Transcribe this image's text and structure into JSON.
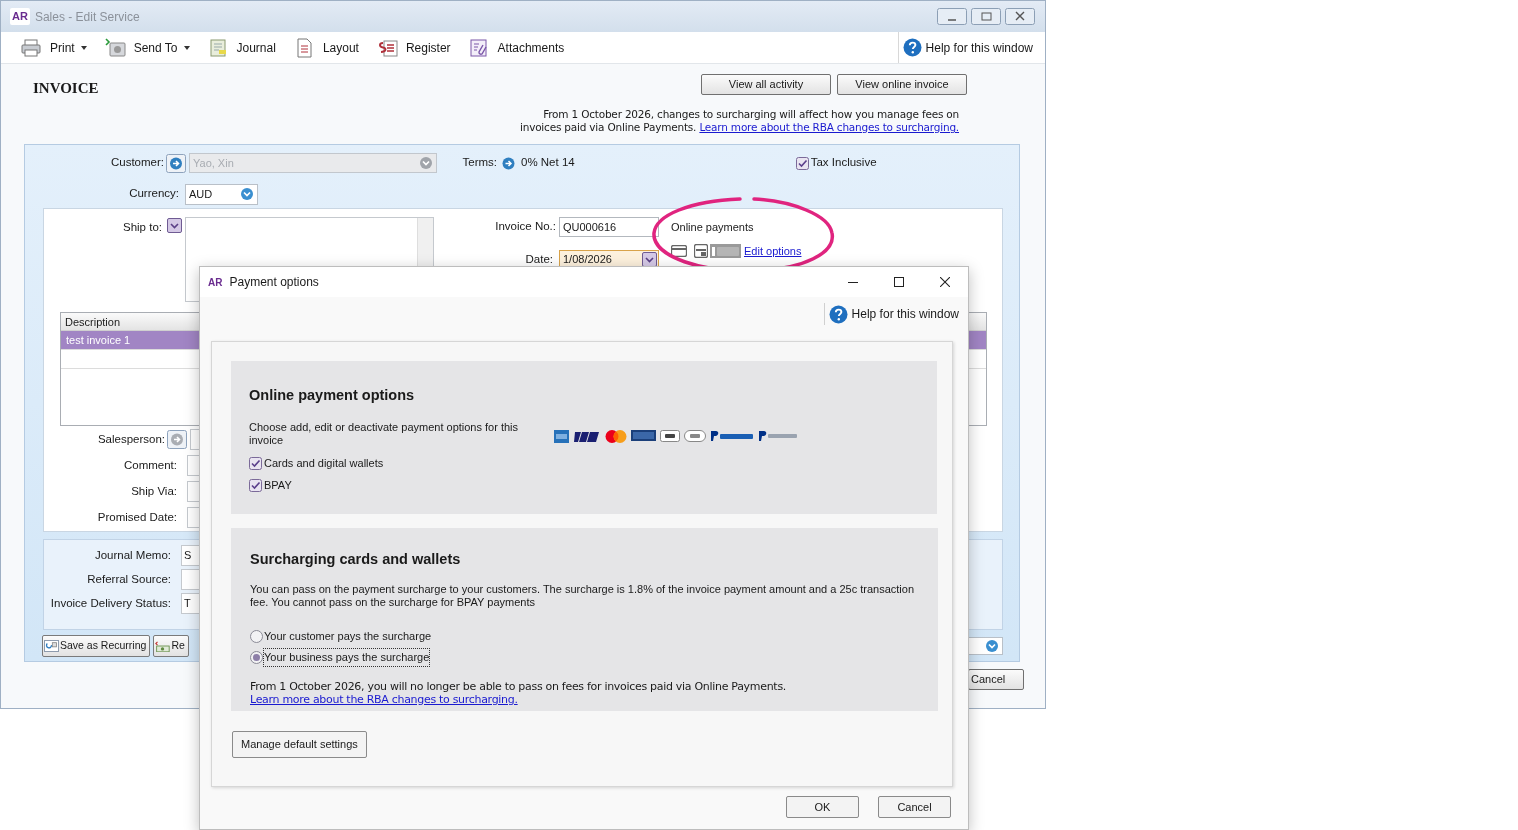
{
  "main_window": {
    "badge": "AR",
    "title": "Sales - Edit Service"
  },
  "toolbar": [
    {
      "kind": "printer",
      "label": "Print",
      "dropdown": true
    },
    {
      "kind": "send",
      "label": "Send To",
      "dropdown": true
    },
    {
      "kind": "journal",
      "label": "Journal",
      "dropdown": false
    },
    {
      "kind": "layout",
      "label": "Layout",
      "dropdown": false
    },
    {
      "kind": "register",
      "label": "Register",
      "dropdown": false
    },
    {
      "kind": "attach",
      "label": "Attachments",
      "dropdown": false
    }
  ],
  "toolbar_help": "Help for this window",
  "heading": "INVOICE",
  "top_buttons": [
    "View all activity",
    "View online invoice"
  ],
  "notice": {
    "text": "From 1 October 2026, changes to surcharging will affect how you manage fees on invoices paid via Online Payments.",
    "link": "Learn more about the RBA changes to surcharging."
  },
  "customer": {
    "label": "Customer:",
    "value": "Yao, Xin",
    "disabled": true
  },
  "terms": {
    "label": "Terms:",
    "value": "0% Net 14"
  },
  "tax_inclusive": {
    "label": "Tax Inclusive",
    "checked": true
  },
  "currency": {
    "label": "Currency:",
    "value": "AUD"
  },
  "ship_to": {
    "label": "Ship to:"
  },
  "invoice_no": {
    "label": "Invoice No.:",
    "value": "QU000616"
  },
  "date": {
    "label": "Date:",
    "value": "1/08/2026"
  },
  "online_payments": {
    "title": "Online payments",
    "link": "Edit options"
  },
  "lines": {
    "columns": [
      "Description"
    ],
    "rows": [
      {
        "cells": [
          "test invoice 1"
        ],
        "selected": true
      }
    ]
  },
  "details": [
    {
      "label": "Salesperson:",
      "kind": "lookup"
    },
    {
      "label": "Comment:",
      "kind": "text"
    },
    {
      "label": "Ship Via:",
      "kind": "text"
    },
    {
      "label": "Promised Date:",
      "kind": "text"
    }
  ],
  "memo_fields": [
    {
      "label": "Journal Memo:",
      "value": "S"
    },
    {
      "label": "Referral Source:"
    },
    {
      "label": "Invoice Delivery Status:",
      "value": "T"
    }
  ],
  "actions": [
    {
      "kind": "recurring",
      "label": "Save as Recurring"
    },
    {
      "kind": "reverse",
      "label": "Re"
    }
  ],
  "cancel": "Cancel",
  "dialog": {
    "badge": "AR",
    "title": "Payment options",
    "help": "Help for this window",
    "options_section": {
      "title": "Online payment options",
      "text": "Choose add, edit or deactivate payment options for this invoice",
      "checks": [
        {
          "label": "Cards and digital wallets",
          "checked": true
        },
        {
          "label": "BPAY",
          "checked": true
        }
      ]
    },
    "surcharge_section": {
      "title": "Surcharging cards and wallets",
      "text": "You can pass on the payment surcharge to your customers. The surcharge is 1.8% of the invoice payment amount and a 25c transaction fee. You cannot pass on the surcharge for BPAY payments",
      "radios": [
        {
          "label": "Your customer pays the surcharge",
          "selected": false
        },
        {
          "label": "Your business pays the surcharge",
          "selected": true
        }
      ],
      "notice": "From 1 October 2026, you will no longer be able to pass on fees for invoices paid via Online Payments.",
      "link": "Learn more about the RBA changes to surcharging."
    },
    "manage_button": "Manage default settings",
    "buttons": [
      "OK",
      "Cancel"
    ]
  }
}
